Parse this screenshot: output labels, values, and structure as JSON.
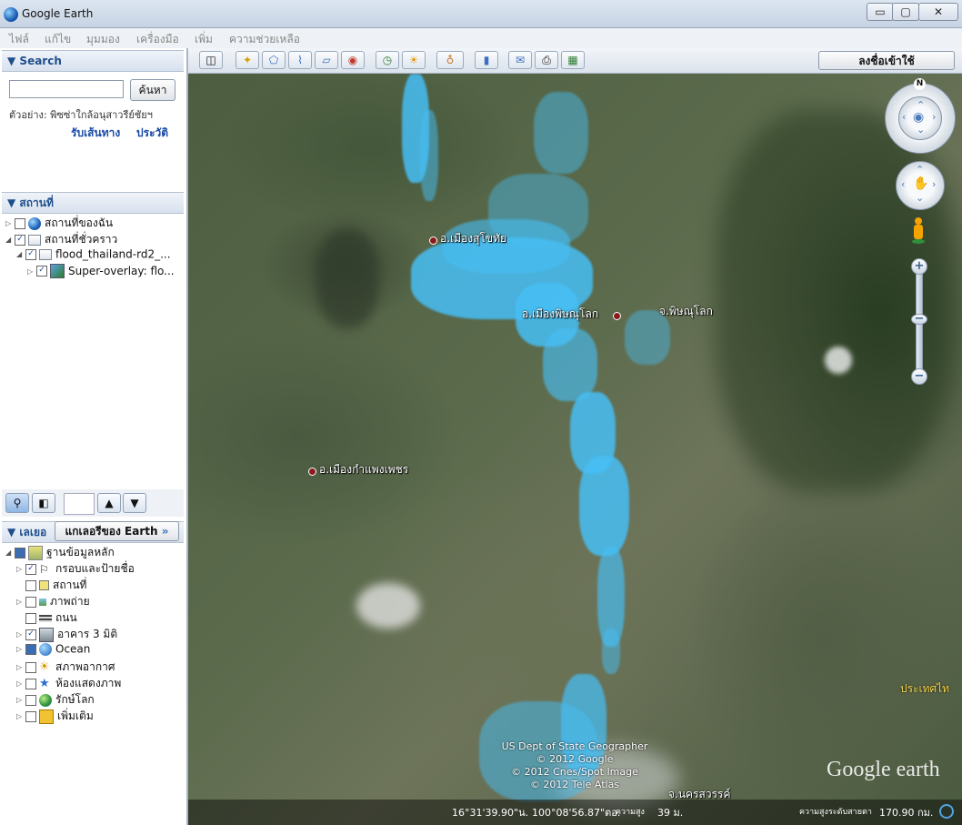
{
  "window": {
    "title": "Google Earth",
    "minimize": "▭",
    "maximize": "▢",
    "close": "✕"
  },
  "menu": [
    "ไฟล์",
    "แก้ไข",
    "มุมมอง",
    "เครื่องมือ",
    "เพิ่ม",
    "ความช่วยเหลือ"
  ],
  "search": {
    "header": "Search",
    "button": "ค้นหา",
    "example": "ตัวอย่าง: พิซซ่าใกล้อนุสาวรีย์ชัยฯ",
    "directions": "รับเส้นทาง",
    "history": "ประวัติ"
  },
  "places": {
    "header": "สถานที่",
    "items": [
      {
        "label": "สถานที่ของฉัน"
      },
      {
        "label": "สถานที่ชั่วคราว"
      },
      {
        "label": "flood_thailand-rd2_..."
      },
      {
        "label": "Super-overlay: flo..."
      }
    ]
  },
  "layers": {
    "header": "เลเยอ",
    "gallery_button": "แกเลอรีของ Earth",
    "items": [
      {
        "label": "ฐานข้อมูลหลัก"
      },
      {
        "label": "กรอบและป้ายชื่อ"
      },
      {
        "label": "สถานที่"
      },
      {
        "label": "ภาพถ่าย"
      },
      {
        "label": "ถนน"
      },
      {
        "label": "อาคาร 3 มิติ"
      },
      {
        "label": "Ocean"
      },
      {
        "label": "สภาพอากาศ"
      },
      {
        "label": "ห้องแสดงภาพ"
      },
      {
        "label": "รักษ์โลก"
      },
      {
        "label": "เพิ่มเติม"
      }
    ]
  },
  "toolbar": {
    "signin": "ลงชื่อเข้าใช้"
  },
  "map": {
    "labels": {
      "sukhothai": "อ.เมืองสุโขทัย",
      "phitsanulok_district": "อ.เมืองพิษณุโลก",
      "phitsanulok_province": "จ.พิษณุโลก",
      "kamphaeng_phet": "อ.เมืองกำแพงเพชร",
      "nakhon_sawan": "จ.นครสวรรค์",
      "country_edge": "ประเทศไท"
    },
    "credits": [
      "US Dept of State Geographer",
      "© 2012 Google",
      "© 2012 Cnes/Spot Image",
      "© 2012 Tele Atlas"
    ],
    "logo": "Google earth",
    "compass_n": "N"
  },
  "status": {
    "lat": "16°31'39.90\"น.",
    "lon": "100°08'56.87\"ตอ.",
    "elev_label": "ความสูง",
    "elev": "39 ม.",
    "eye_label": "ความสูงระดับสายตา",
    "eye": "170.90 กม."
  }
}
